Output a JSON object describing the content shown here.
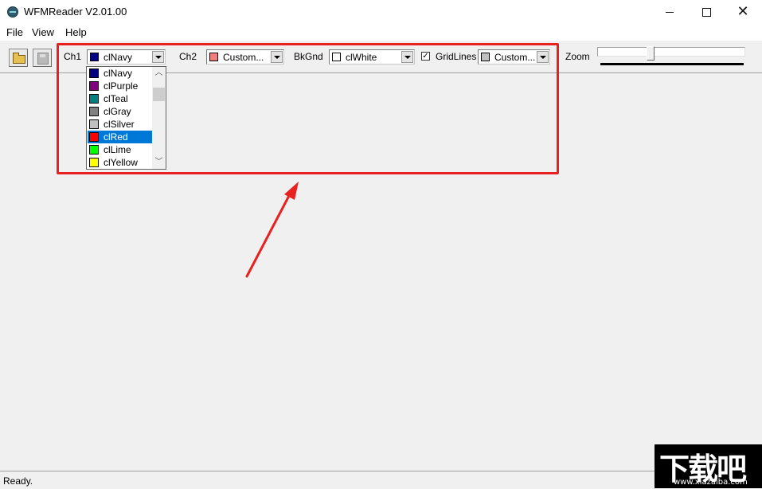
{
  "window": {
    "title": "WFMReader V2.01.00"
  },
  "menu": {
    "file": "File",
    "view": "View",
    "help": "Help"
  },
  "toolbar": {
    "open_icon": "folder-open-icon",
    "save_icon": "floppy-disk-icon",
    "ch1_label": "Ch1",
    "ch1_value": "clNavy",
    "ch1_color": "#000080",
    "ch2_label": "Ch2",
    "ch2_value": "Custom...",
    "ch2_color": "#f08080",
    "bkgnd_label": "BkGnd",
    "bkgnd_value": "clWhite",
    "bkgnd_color": "#ffffff",
    "gridlines_label": "GridLines",
    "gridlines_checked": true,
    "gridlines_value": "Custom...",
    "gridlines_color": "#c0c0c0",
    "zoom_label": "Zoom"
  },
  "dropdown": {
    "items": [
      {
        "label": "clNavy",
        "color": "#000080",
        "selected": false
      },
      {
        "label": "clPurple",
        "color": "#800080",
        "selected": false
      },
      {
        "label": "clTeal",
        "color": "#008080",
        "selected": false
      },
      {
        "label": "clGray",
        "color": "#808080",
        "selected": false
      },
      {
        "label": "clSilver",
        "color": "#c0c0c0",
        "selected": false
      },
      {
        "label": "clRed",
        "color": "#ff0000",
        "selected": true
      },
      {
        "label": "clLime",
        "color": "#00ff00",
        "selected": false
      },
      {
        "label": "clYellow",
        "color": "#ffff00",
        "selected": false
      }
    ]
  },
  "annotation": {
    "highlight_color": "#e8201f"
  },
  "status": {
    "text": "Ready."
  },
  "watermark": {
    "main": "下载吧",
    "sub": "www.xiazaiba.com"
  }
}
